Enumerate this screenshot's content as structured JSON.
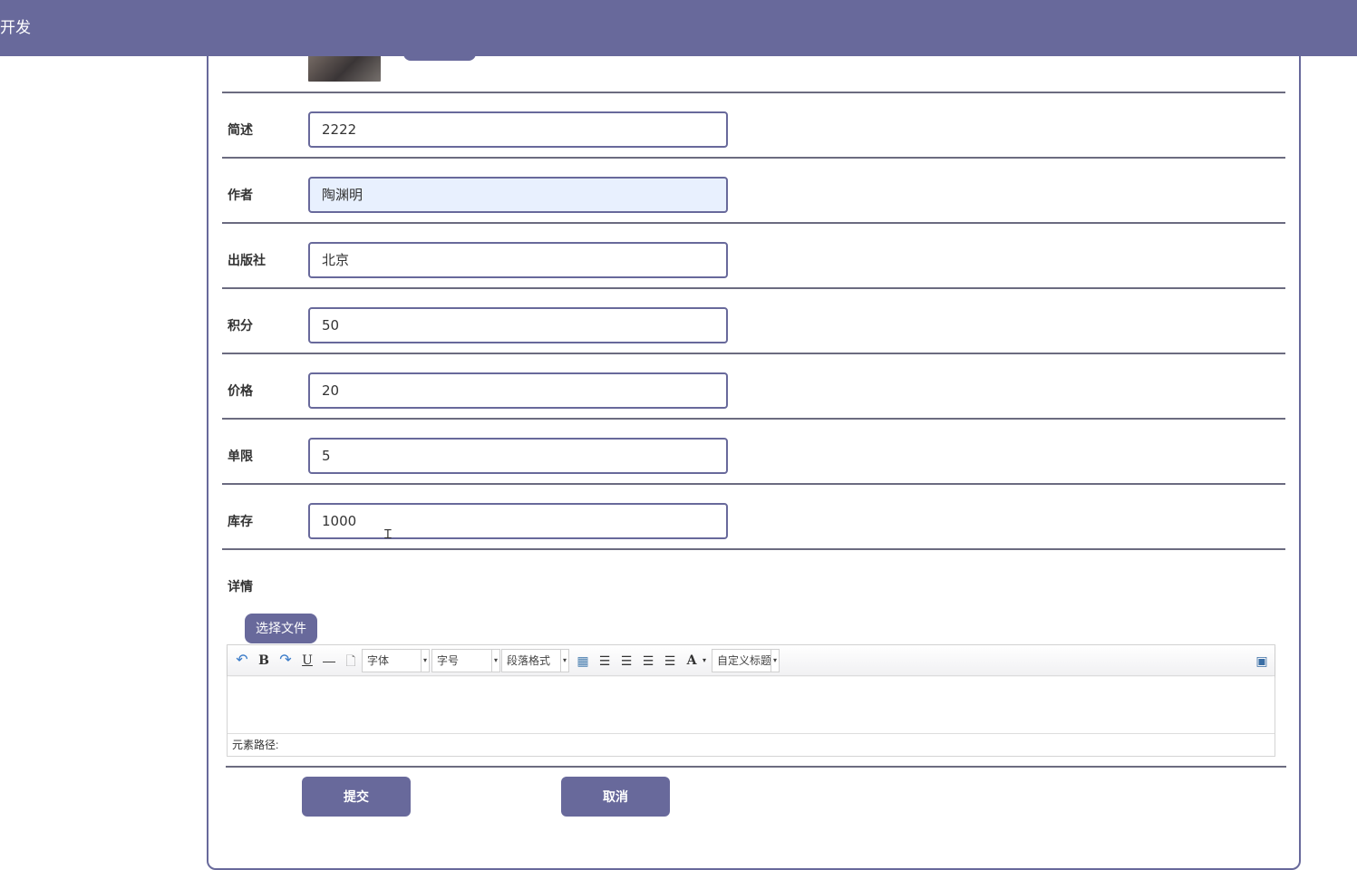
{
  "header": {
    "title": "开发",
    "color": "#68699b"
  },
  "form": {
    "rows": [
      {
        "label": "简述",
        "value": "2222"
      },
      {
        "label": "作者",
        "value": "陶渊明"
      },
      {
        "label": "出版社",
        "value": "北京"
      },
      {
        "label": "积分",
        "value": "50"
      },
      {
        "label": "价格",
        "value": "20"
      },
      {
        "label": "单限",
        "value": "5"
      },
      {
        "label": "库存",
        "value": "1000"
      }
    ],
    "detail_label": "详情",
    "file_button": "选择文件"
  },
  "editor": {
    "toolbar": {
      "undo": "undo-icon",
      "bold": "B",
      "redo": "redo-icon",
      "underline": "U",
      "hr": "—",
      "font_family": "字体",
      "font_size": "字号",
      "paragraph": "段落格式",
      "font_color": "A",
      "custom_title": "自定义标题"
    },
    "path_label": "元素路径:"
  },
  "actions": {
    "submit": "提交",
    "cancel": "取消"
  }
}
